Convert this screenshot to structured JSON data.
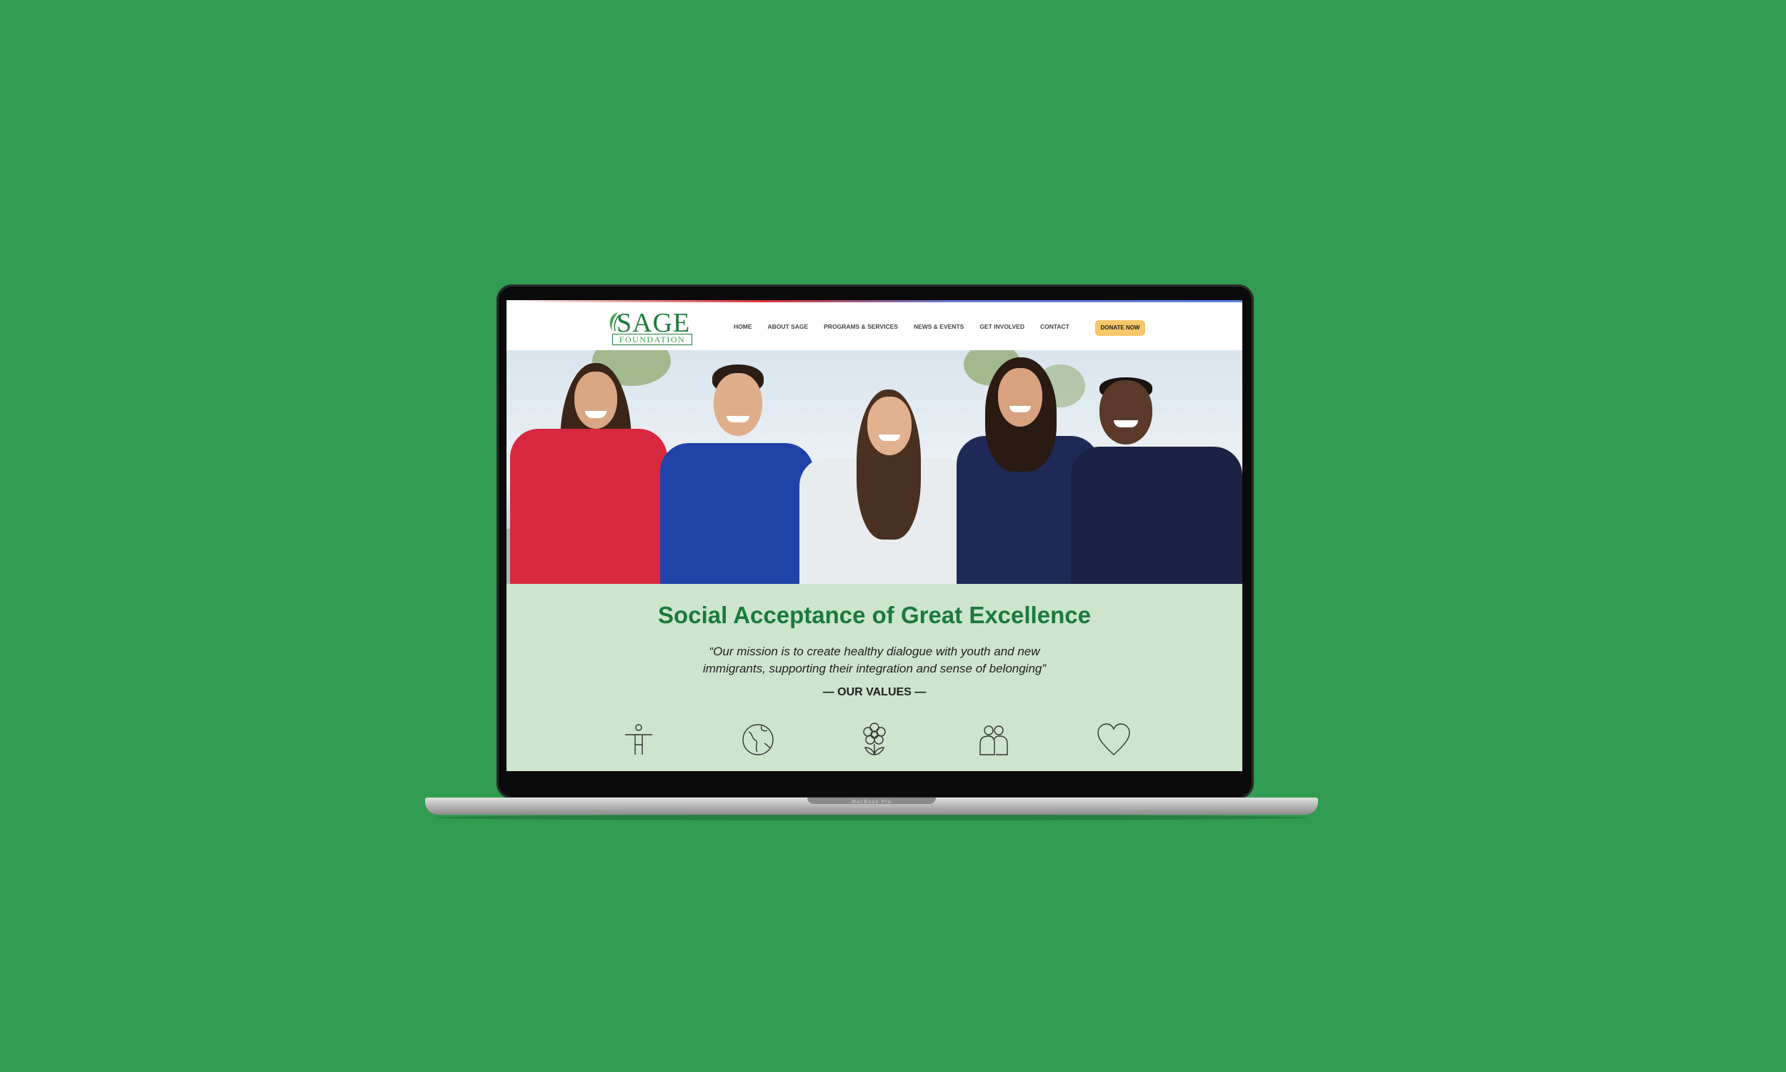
{
  "colors": {
    "page_background": "#309b51",
    "brand_green": "#1a7a3b",
    "band_background": "#cde5cd",
    "donate_button": "#f7c76a"
  },
  "logo": {
    "title": "SAGE",
    "subtitle": "FOUNDATION"
  },
  "nav": {
    "items": [
      {
        "label": "HOME"
      },
      {
        "label": "ABOUT SAGE"
      },
      {
        "label": "PROGRAMS & SERVICES"
      },
      {
        "label": "NEWS & EVENTS"
      },
      {
        "label": "GET INVOLVED"
      },
      {
        "label": "CONTACT"
      }
    ],
    "donate_label": "DONATE NOW"
  },
  "hero": {
    "image": "group-of-five-smiling-young-people-photo"
  },
  "mission": {
    "title": "Social Acceptance of Great Excellence",
    "quote_line1": "“Our mission is to create healthy dialogue with youth and new",
    "quote_line2": "immigrants, supporting their integration and sense of belonging”",
    "values_label": "— OUR VALUES —"
  },
  "values": {
    "icons": [
      "person-icon",
      "globe-icon",
      "flower-icon",
      "people-icon",
      "heart-icon"
    ]
  },
  "device": {
    "model_label": "MacBook Pro"
  }
}
